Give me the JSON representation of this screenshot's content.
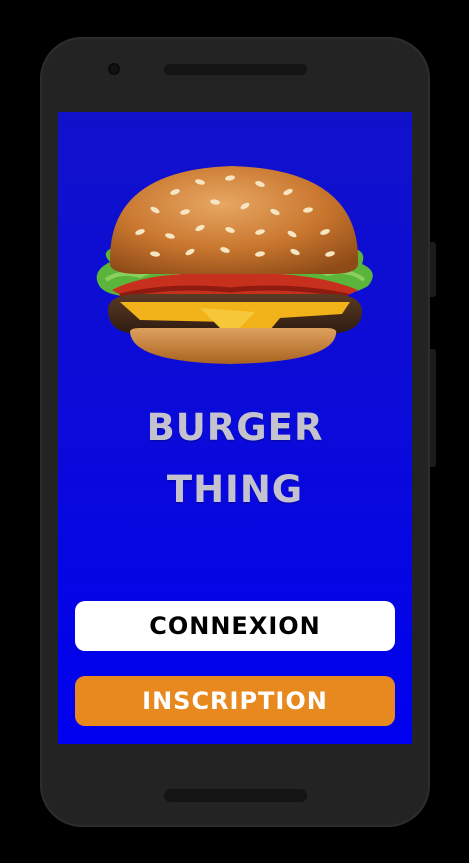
{
  "app": {
    "title_line1": "BURGER",
    "title_line2": "THING"
  },
  "buttons": {
    "login_label": "CONNEXION",
    "signup_label": "INSCRIPTION"
  },
  "colors": {
    "screen_background": "#0a0ae0",
    "title_text": "#c4c2cc",
    "login_button_bg": "#ffffff",
    "signup_button_bg": "#e8891f"
  },
  "images": {
    "hero": "burger-image"
  }
}
